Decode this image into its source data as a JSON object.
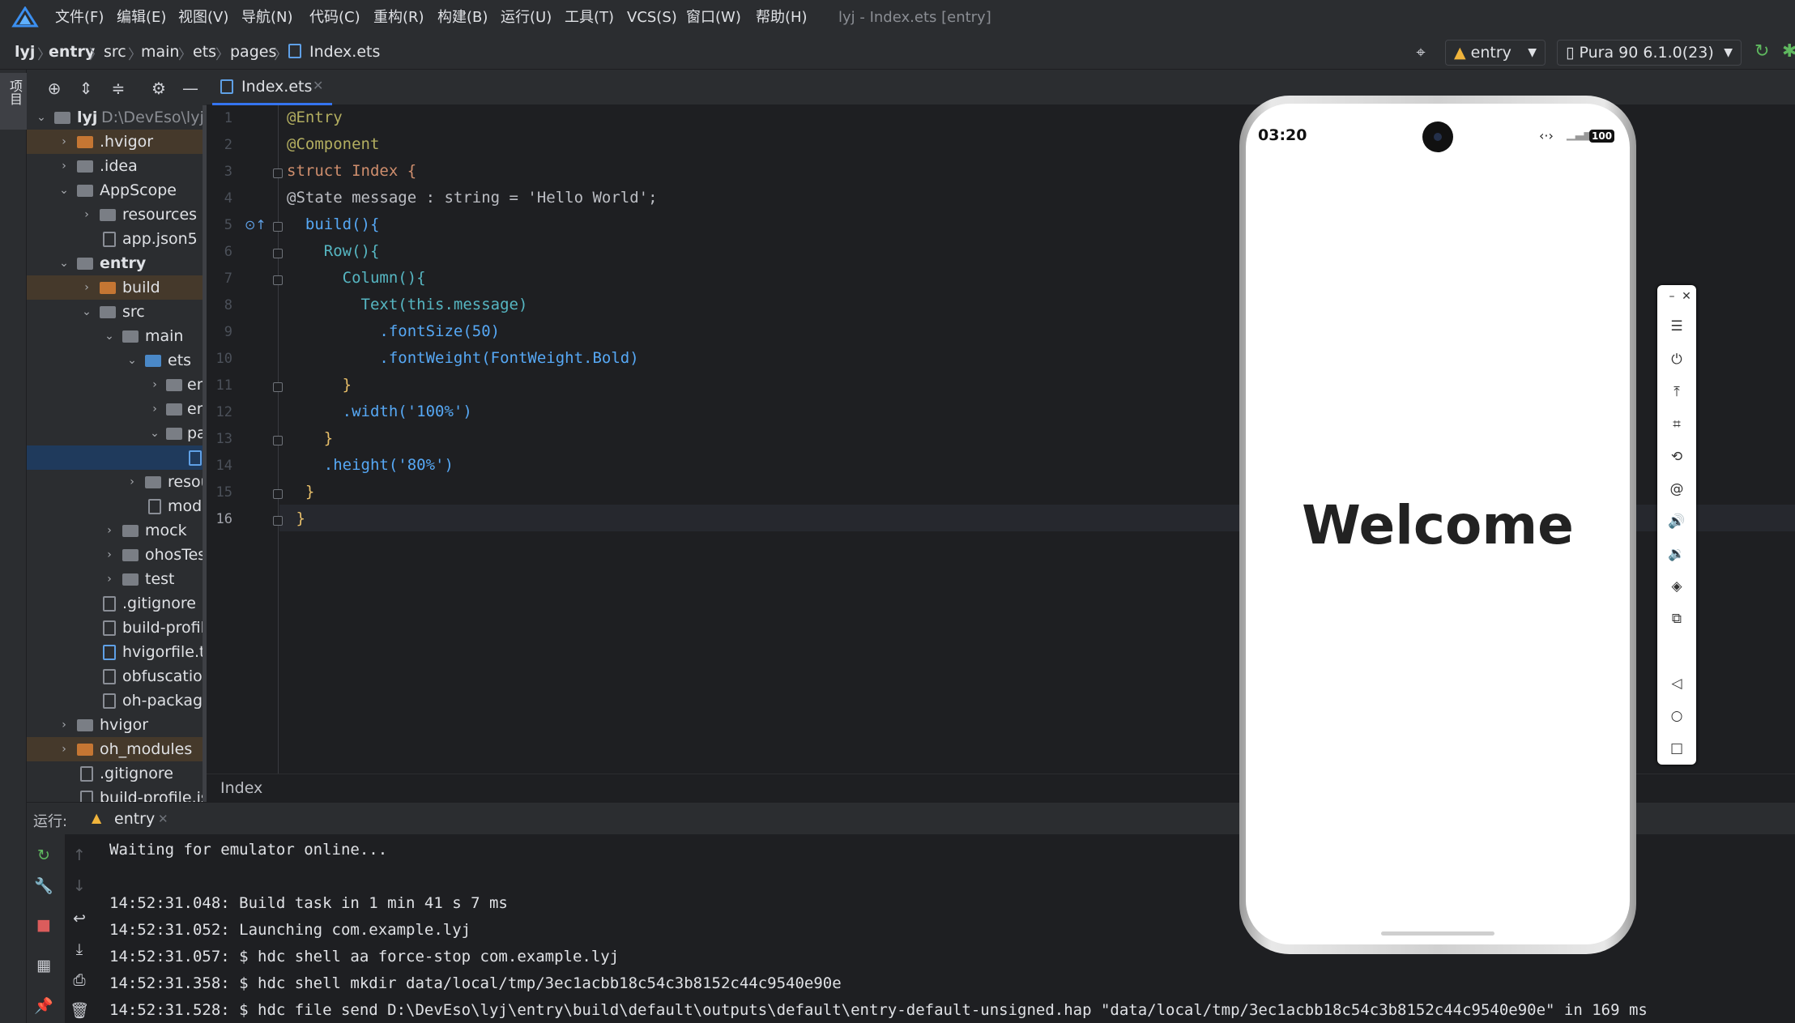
{
  "app": {
    "window_title": "lyj - Index.ets [entry]"
  },
  "menu": [
    "文件(F)",
    "编辑(E)",
    "视图(V)",
    "导航(N)",
    "代码(C)",
    "重构(R)",
    "构建(B)",
    "运行(U)",
    "工具(T)",
    "VCS(S)",
    "窗口(W)",
    "帮助(H)"
  ],
  "breadcrumb": [
    "lyj",
    "entry",
    "src",
    "main",
    "ets",
    "pages",
    "Index.ets"
  ],
  "toolbar": {
    "run_config": "entry",
    "device": "Pura 90 6.1.0(23)"
  },
  "left_strip": {
    "project_label": "项目"
  },
  "project_tree": [
    {
      "label": ".hvigor",
      "detail": ""
    },
    {
      "label": ".idea",
      "detail": ""
    },
    {
      "label": "AppScope",
      "detail": ""
    },
    {
      "label": "resources",
      "detail": ""
    },
    {
      "label": "app.json5",
      "detail": ""
    },
    {
      "label": "entry",
      "detail": ""
    },
    {
      "label": "build",
      "detail": ""
    },
    {
      "label": "src",
      "detail": ""
    },
    {
      "label": "main",
      "detail": ""
    },
    {
      "label": "ets",
      "detail": ""
    },
    {
      "label": "en",
      "detail": ""
    },
    {
      "label": "en",
      "detail": ""
    },
    {
      "label": "pa",
      "detail": ""
    },
    {
      "label": "",
      "detail": ""
    },
    {
      "label": "resou",
      "detail": ""
    },
    {
      "label": "modu",
      "detail": ""
    },
    {
      "label": "mock",
      "detail": ""
    },
    {
      "label": "ohosTest",
      "detail": ""
    },
    {
      "label": "test",
      "detail": ""
    },
    {
      "label": ".gitignore",
      "detail": ""
    },
    {
      "label": "build-profile",
      "detail": ""
    },
    {
      "label": "hvigorfile.ts",
      "detail": ""
    },
    {
      "label": "obfuscation",
      "detail": ""
    },
    {
      "label": "oh-package",
      "detail": ""
    },
    {
      "label": "hvigor",
      "detail": ""
    },
    {
      "label": "oh_modules",
      "detail": ""
    },
    {
      "label": ".gitignore",
      "detail": ""
    },
    {
      "label": "build-profile.js",
      "detail": ""
    }
  ],
  "project_root": {
    "name": "lyj",
    "path": "D:\\DevEso\\lyj"
  },
  "editor": {
    "tab": "Index.ets",
    "bottom_breadcrumb": "Index",
    "lines": [
      {
        "n": "1",
        "t": "@Entry"
      },
      {
        "n": "2",
        "t": "@Component"
      },
      {
        "n": "3",
        "t": "struct Index {"
      },
      {
        "n": "4",
        "t": "@State message : string = 'Hello World';"
      },
      {
        "n": "5",
        "t": "  build(){"
      },
      {
        "n": "6",
        "t": "    Row(){"
      },
      {
        "n": "7",
        "t": "      Column(){"
      },
      {
        "n": "8",
        "t": "        Text(this.message)"
      },
      {
        "n": "9",
        "t": "          .fontSize(50)"
      },
      {
        "n": "10",
        "t": "          .fontWeight(FontWeight.Bold)"
      },
      {
        "n": "11",
        "t": "      }"
      },
      {
        "n": "12",
        "t": "      .width('100%')"
      },
      {
        "n": "13",
        "t": "    }"
      },
      {
        "n": "14",
        "t": "    .height('80%')"
      },
      {
        "n": "15",
        "t": "  }"
      },
      {
        "n": "16",
        "t": " }"
      }
    ]
  },
  "run": {
    "label": "运行:",
    "tab": "entry",
    "output": [
      "Waiting for emulator online...",
      "",
      "14:52:31.048: Build task in 1 min 41 s 7 ms",
      "14:52:31.052: Launching com.example.lyj",
      "14:52:31.057: $ hdc shell aa force-stop com.example.lyj",
      "14:52:31.358: $ hdc shell mkdir data/local/tmp/3ec1acbb18c54c3b8152c44c9540e90e",
      "14:52:31.528: $ hdc file send D:\\DevEso\\lyj\\entry\\build\\default\\outputs\\default\\entry-default-unsigned.hap \"data/local/tmp/3ec1acbb18c54c3b8152c44c9540e90e\" in 169 ms"
    ]
  },
  "phone": {
    "time": "03:20",
    "battery": "100",
    "screen_text": "Welcome"
  },
  "emulator_controls": [
    "minimize-icon",
    "close-icon",
    "menu-icon",
    "power-icon",
    "rotate-up-icon",
    "crop-icon",
    "rotate-icon",
    "gesture-icon",
    "volume-up-icon",
    "volume-down-icon",
    "shake-icon",
    "screenshot-icon",
    "back-icon",
    "home-icon",
    "recents-icon"
  ]
}
